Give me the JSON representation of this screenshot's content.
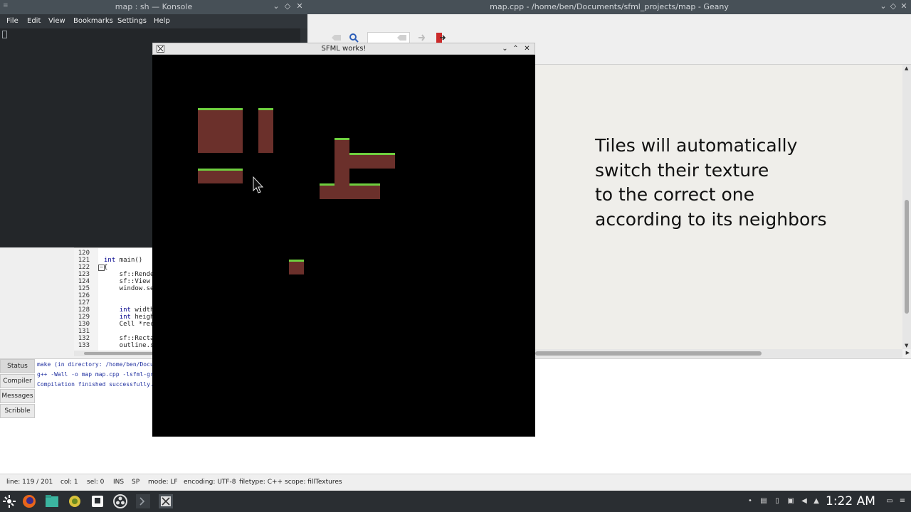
{
  "geany": {
    "title": "map.cpp - /home/ben/Documents/sfml_projects/map - Geany",
    "code": {
      "lines": [
        {
          "num": "120",
          "text": ""
        },
        {
          "num": "121",
          "text": "int main()"
        },
        {
          "num": "122",
          "text": "{"
        },
        {
          "num": "123",
          "text": "    sf::Rende"
        },
        {
          "num": "124",
          "text": "    sf::View"
        },
        {
          "num": "125",
          "text": "    window.se"
        },
        {
          "num": "126",
          "text": ""
        },
        {
          "num": "127",
          "text": ""
        },
        {
          "num": "128",
          "text": "    int width"
        },
        {
          "num": "129",
          "text": "    int heigh"
        },
        {
          "num": "130",
          "text": "    Cell *rec"
        },
        {
          "num": "131",
          "text": ""
        },
        {
          "num": "132",
          "text": "    sf::Recta"
        },
        {
          "num": "133",
          "text": "    outline.s"
        }
      ]
    },
    "message_tabs": [
      "Status",
      "Compiler",
      "Messages",
      "Scribble"
    ],
    "compiler_output": [
      "make (in directory: /home/ben/Docum",
      "g++ -Wall -o map map.cpp -lsfml-gra",
      "Compilation finished successfully."
    ],
    "statusbar": {
      "line": "line: 119 / 201",
      "col": "col: 1",
      "sel": "sel: 0",
      "ins": "INS",
      "sp": "SP",
      "mode": "mode: LF",
      "encoding": "encoding: UTF-8",
      "filetype": "filetype: C++",
      "scope": "scope: fillTextures"
    }
  },
  "konsole": {
    "title": "map : sh — Konsole",
    "menu": [
      "File",
      "Edit",
      "View",
      "Bookmarks",
      "Settings",
      "Help"
    ]
  },
  "sfml": {
    "title": "SFML works!",
    "colors": {
      "dirt": "#6b302b",
      "grass": "#6fcf3f",
      "background": "#000000"
    }
  },
  "caption": {
    "lines": [
      "Tiles will automatically",
      "switch their texture",
      "to the correct one",
      "according to its neighbors"
    ]
  },
  "taskbar": {
    "clock": "1:22 AM",
    "icons": [
      "application-launcher-icon",
      "firefox-icon",
      "files-icon",
      "geany-icon",
      "notes-icon",
      "obs-icon",
      "terminal-icon",
      "x11-app-icon"
    ]
  }
}
